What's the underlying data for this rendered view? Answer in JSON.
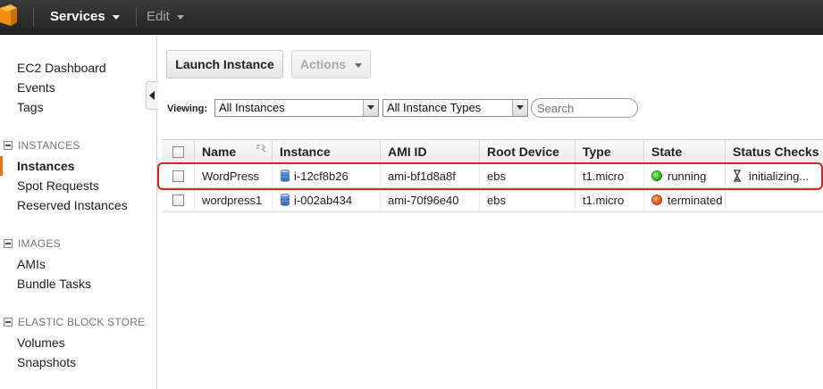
{
  "topbar": {
    "services_label": "Services",
    "edit_label": "Edit"
  },
  "sidebar": {
    "links_top": [
      "EC2 Dashboard",
      "Events",
      "Tags"
    ],
    "sections": [
      {
        "title": "INSTANCES",
        "items": [
          "Instances",
          "Spot Requests",
          "Reserved Instances"
        ]
      },
      {
        "title": "IMAGES",
        "items": [
          "AMIs",
          "Bundle Tasks"
        ]
      },
      {
        "title": "ELASTIC BLOCK STORE",
        "items": [
          "Volumes",
          "Snapshots"
        ]
      }
    ],
    "active_item": "Instances"
  },
  "toolbar": {
    "launch_label": "Launch Instance",
    "actions_label": "Actions"
  },
  "filters": {
    "viewing_label": "Viewing:",
    "view_value": "All Instances",
    "type_value": "All Instance Types",
    "search_placeholder": "Search"
  },
  "table": {
    "columns": [
      "Name",
      "Instance",
      "AMI ID",
      "Root Device",
      "Type",
      "State",
      "Status Checks"
    ],
    "rows": [
      {
        "name": "WordPress",
        "instance": "i-12cf8b26",
        "ami": "ami-bf1d8a8f",
        "root": "ebs",
        "type": "t1.micro",
        "state": "running",
        "status": "initializing..."
      },
      {
        "name": "wordpress1",
        "instance": "i-002ab434",
        "ami": "ami-70f96e40",
        "root": "ebs",
        "type": "t1.micro",
        "state": "terminated",
        "status": ""
      }
    ]
  },
  "colors": {
    "accent": "#e47911",
    "running": "#2ea81a",
    "terminated": "#e2461a",
    "highlight": "#d2281d"
  },
  "icons": {
    "logo": "aws-cube-icon",
    "instance": "database-icon",
    "status": "hourglass-icon"
  }
}
